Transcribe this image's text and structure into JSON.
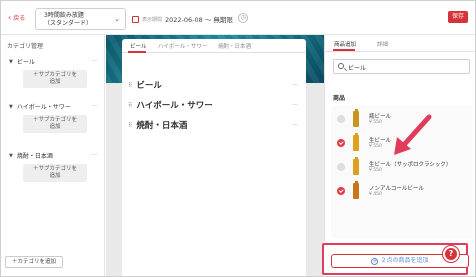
{
  "topbar": {
    "back_label": "戻る",
    "plan_line1": "3時間飲み放題",
    "plan_line2": "（スタンダード）",
    "period_label": "表示期間",
    "period_value": "2022-06-08 〜 無期限",
    "save_label": "保存"
  },
  "sidebar": {
    "title": "カテゴリ管理",
    "categories": [
      {
        "label": "ビール",
        "sub_button": "＋サブカテゴリを\n追加"
      },
      {
        "label": "ハイボール・サワー",
        "sub_button": "＋サブカテゴリを\n追加"
      },
      {
        "label": "焼酎・日本酒",
        "sub_button": "＋サブカテゴリを\n追加"
      }
    ],
    "add_category_label": "＋カテゴリを追加"
  },
  "middle": {
    "tabs": [
      "ビール",
      "ハイボール・サワー",
      "焼酎・日本酒"
    ],
    "active_tab": 0,
    "categories": [
      "ビール",
      "ハイボール・サワー",
      "焼酎・日本酒"
    ]
  },
  "right": {
    "tabs": [
      "商品追加",
      "詳細"
    ],
    "active_tab": 0,
    "search_value": "ビール",
    "section_label": "商品",
    "products": [
      {
        "name": "瓶ビール",
        "price": "¥ 550",
        "checked": false,
        "bottle_color": "#c8951f"
      },
      {
        "name": "生ビール",
        "price": "¥ 550",
        "checked": true,
        "bottle_color": "#e0a21c"
      },
      {
        "name": "生ビール（サッポロクラシック）",
        "price": "¥ 550",
        "checked": false,
        "bottle_color": "#d9a021"
      },
      {
        "name": "ノンアルコールビール",
        "price": "¥ 450",
        "checked": true,
        "bottle_color": "#c9761a"
      }
    ],
    "add_button_label": "２点の商品を追加",
    "help_label": "?"
  },
  "colors": {
    "accent": "#d6333a",
    "highlight": "#e23c5c"
  }
}
